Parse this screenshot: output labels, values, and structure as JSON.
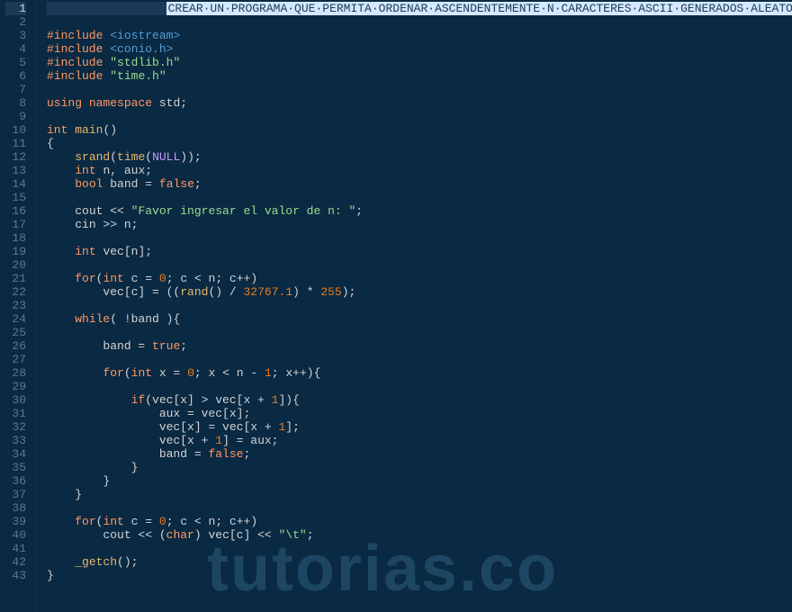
{
  "banner": "CREAR·UN·PROGRAMA·QUE·PERMITA·ORDENAR·ASCENDENTEMENTE·N·CARACTERES·ASCII·GENERADOS·ALEATORIAMENTE",
  "watermark": "tutorias.co",
  "lines": [
    {
      "n": 1,
      "active": true
    },
    {
      "n": 2
    },
    {
      "n": 3
    },
    {
      "n": 4
    },
    {
      "n": 5
    },
    {
      "n": 6
    },
    {
      "n": 7
    },
    {
      "n": 8
    },
    {
      "n": 9
    },
    {
      "n": 10
    },
    {
      "n": 11
    },
    {
      "n": 12
    },
    {
      "n": 13
    },
    {
      "n": 14
    },
    {
      "n": 15
    },
    {
      "n": 16
    },
    {
      "n": 17
    },
    {
      "n": 18
    },
    {
      "n": 19
    },
    {
      "n": 20
    },
    {
      "n": 21
    },
    {
      "n": 22
    },
    {
      "n": 23
    },
    {
      "n": 24
    },
    {
      "n": 25
    },
    {
      "n": 26
    },
    {
      "n": 27
    },
    {
      "n": 28
    },
    {
      "n": 29
    },
    {
      "n": 30
    },
    {
      "n": 31
    },
    {
      "n": 32
    },
    {
      "n": 33
    },
    {
      "n": 34
    },
    {
      "n": 35
    },
    {
      "n": 36
    },
    {
      "n": 37
    },
    {
      "n": 38
    },
    {
      "n": 39
    },
    {
      "n": 40
    },
    {
      "n": 41
    },
    {
      "n": 42
    },
    {
      "n": 43
    }
  ],
  "code": {
    "l3_include": "#include",
    "l3_hdr": "<iostream>",
    "l4_include": "#include",
    "l4_hdr": "<conio.h>",
    "l5_include": "#include",
    "l5_hdr": "\"stdlib.h\"",
    "l6_include": "#include",
    "l6_hdr": "\"time.h\"",
    "l8_using": "using",
    "l8_namespace": "namespace",
    "l8_std": "std;",
    "l10_int": "int",
    "l10_main": "main",
    "l10_paren": "()",
    "l11_brace": "{",
    "l12_srand": "srand",
    "l12_time": "time",
    "l12_null": "NULL",
    "l13_int": "int",
    "l13_vars": "n, aux;",
    "l14_bool": "bool",
    "l14_band": "band",
    "l14_eq": "=",
    "l14_false": "false",
    "l16_cout": "cout <<",
    "l16_str": "\"Favor ingresar el valor de n: \"",
    "l17_cin": "cin >> n;",
    "l19_int": "int",
    "l19_vec": "vec[n];",
    "l21_for": "for",
    "l21_int": "int",
    "l21_c": "c",
    "l21_eq": "=",
    "l21_zero": "0",
    "l21_cond": "; c < n; c++)",
    "l22_body": "vec[c] = ((",
    "l22_rand": "rand",
    "l22_div": "() /",
    "l22_n1": "32767.1",
    "l22_mul": ") *",
    "l22_n2": "255",
    "l22_end": ");",
    "l24_while": "while",
    "l24_cond": "( !band ){",
    "l26_body": "band =",
    "l26_true": "true",
    "l28_for": "for",
    "l28_int": "int",
    "l28_x": "x",
    "l28_eq": "=",
    "l28_zero": "0",
    "l28_mid": "; x < n -",
    "l28_one": "1",
    "l28_end": "; x++){",
    "l30_if": "if",
    "l30_cond1": "(vec[x] > vec[x +",
    "l30_one": "1",
    "l30_cond2": "]){",
    "l31_body": "aux = vec[x];",
    "l32_body1": "vec[x] = vec[x +",
    "l32_one": "1",
    "l32_body2": "];",
    "l33_body1": "vec[x +",
    "l33_one": "1",
    "l33_body2": "] = aux;",
    "l34_body": "band =",
    "l34_false": "false",
    "l35_brace": "}",
    "l36_brace": "}",
    "l37_brace": "}",
    "l39_for": "for",
    "l39_int": "int",
    "l39_c": "c",
    "l39_eq": "=",
    "l39_zero": "0",
    "l39_cond": "; c < n; c++)",
    "l40_body1": "cout << (",
    "l40_char": "char",
    "l40_body2": ") vec[c] <<",
    "l40_tab": "\"\\t\"",
    "l40_end": ";",
    "l42_getch": "_getch",
    "l42_end": "();",
    "l43_brace": "}"
  }
}
